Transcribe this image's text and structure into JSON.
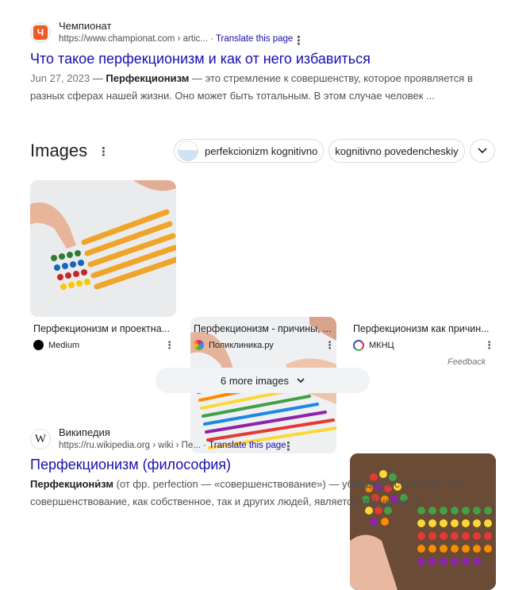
{
  "result1": {
    "site_name": "Чемпионат",
    "url": "https://www.championat.com › artic...",
    "translate": "Translate this page",
    "title": "Что такое перфекционизм и как от него избавиться",
    "date": "Jun 27, 2023",
    "dash": " — ",
    "bold": "Перфекционизм",
    "snippet": " — это стремление к совершенству, которое проявляется в разных сферах нашей жизни. Оно может быть тотальным. В этом случае человек ...",
    "favicon_letter": "Ч",
    "favicon_color": "#f15a24"
  },
  "images": {
    "heading": "Images",
    "chips": [
      "perfekcionizm kognitivno",
      "kognitivno povedencheskiy"
    ],
    "cards": [
      {
        "title": "Перфекционизм и проектна...",
        "source": "Medium",
        "source_color": "#000000"
      },
      {
        "title": "Перфекционизм - причины, ...",
        "source": "Поликлиника.ру",
        "source_color": "#e91e63"
      },
      {
        "title": "Перфекционизм как причин...",
        "source": "МКНЦ",
        "source_color": "#3f51b5"
      }
    ],
    "feedback": "Feedback",
    "more": "6 more images"
  },
  "result2": {
    "site_name": "Википедия",
    "url": "https://ru.wikipedia.org › wiki › Пе...",
    "translate": "Translate this page",
    "title": "Перфекционизм (философия)",
    "bold": "Перфекциони́зм",
    "snippet": " (от фр. perfection — «совершенствование») — убеждённость в том, что совершенствование, как собственное, так и других людей, является той целью, к ...",
    "favicon_letter": "W"
  }
}
